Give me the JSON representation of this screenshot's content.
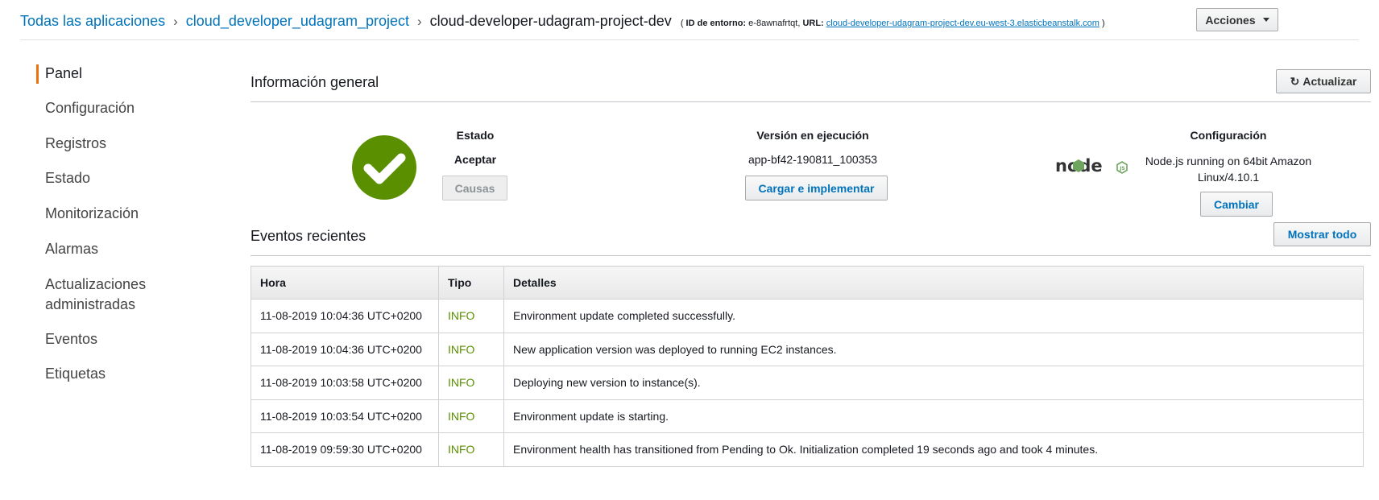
{
  "breadcrumb": {
    "root": "Todas las aplicaciones",
    "app": "cloud_developer_udagram_project",
    "env": "cloud-developer-udagram-project-dev",
    "env_id_label": "ID de entorno:",
    "env_id": "e-8awnafrtqt,",
    "url_label": "URL:",
    "url": "cloud-developer-udagram-project-dev.eu-west-3.elasticbeanstalk.com",
    "open_paren": "(",
    "close_paren": ")",
    "separator": "›"
  },
  "actions_button": "Acciones",
  "sidebar": {
    "items": [
      {
        "label": "Panel",
        "active": true
      },
      {
        "label": "Configuración"
      },
      {
        "label": "Registros"
      },
      {
        "label": "Estado"
      },
      {
        "label": "Monitorización"
      },
      {
        "label": "Alarmas"
      },
      {
        "label": "Actualizaciones administradas"
      },
      {
        "label": "Eventos"
      },
      {
        "label": "Etiquetas"
      }
    ]
  },
  "overview": {
    "title": "Información general",
    "refresh_button": "Actualizar",
    "health": {
      "label": "Estado",
      "value": "Aceptar",
      "causes_button": "Causas",
      "icon": "check-circle-icon",
      "color": "#5a8f00"
    },
    "version": {
      "label": "Versión en ejecución",
      "value": "app-bf42-190811_100353",
      "button": "Cargar e implementar"
    },
    "config": {
      "label": "Configuración",
      "value": "Node.js running on 64bit Amazon Linux/4.10.1",
      "button": "Cambiar",
      "logo": "node",
      "logo_badge": "JS"
    }
  },
  "events": {
    "title": "Eventos recientes",
    "show_all_button": "Mostrar todo",
    "columns": [
      "Hora",
      "Tipo",
      "Detalles"
    ],
    "rows": [
      {
        "time": "11-08-2019 10:04:36 UTC+0200",
        "type": "INFO",
        "details": "Environment update completed successfully."
      },
      {
        "time": "11-08-2019 10:04:36 UTC+0200",
        "type": "INFO",
        "details": "New application version was deployed to running EC2 instances."
      },
      {
        "time": "11-08-2019 10:03:58 UTC+0200",
        "type": "INFO",
        "details": "Deploying new version to instance(s)."
      },
      {
        "time": "11-08-2019 10:03:54 UTC+0200",
        "type": "INFO",
        "details": "Environment update is starting."
      },
      {
        "time": "11-08-2019 09:59:30 UTC+0200",
        "type": "INFO",
        "details": "Environment health has transitioned from Pending to Ok. Initialization completed 19 seconds ago and took 4 minutes."
      }
    ]
  },
  "colors": {
    "accent": "#ec7211",
    "link": "#0073bb",
    "info": "#5a8f00"
  }
}
